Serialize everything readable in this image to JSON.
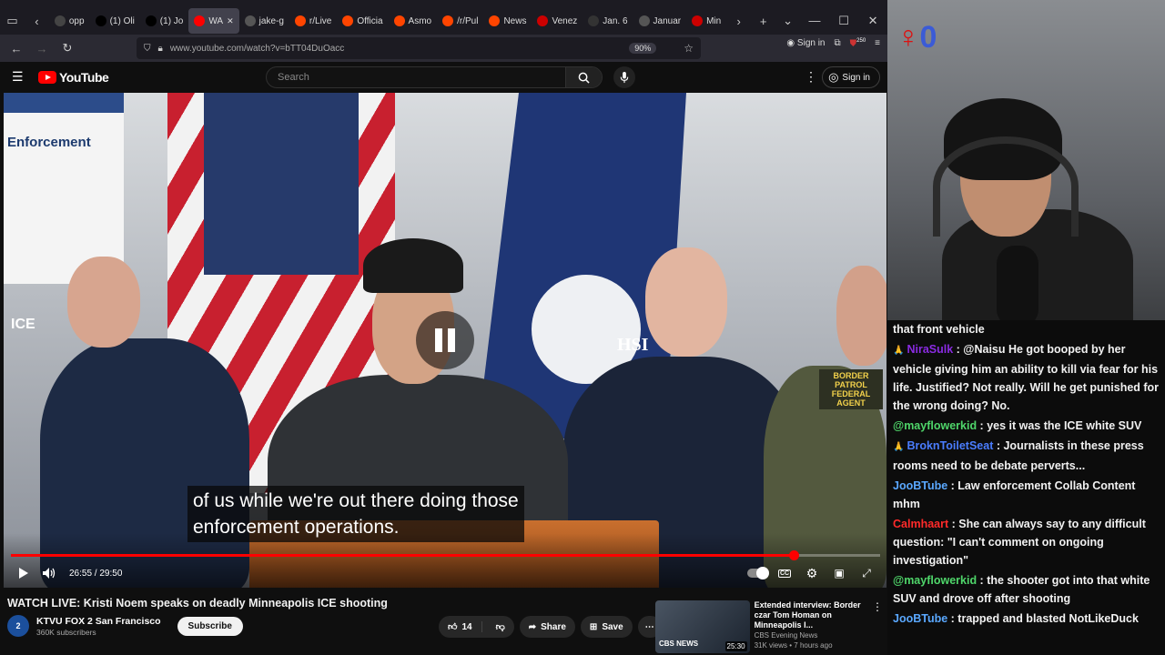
{
  "browser": {
    "tabs": [
      {
        "label": "opp",
        "color": "#444"
      },
      {
        "label": "(1) Oli",
        "color": "#000"
      },
      {
        "label": "(1) Jo",
        "color": "#000"
      },
      {
        "label": "WA",
        "color": "#ff0000",
        "active": true
      },
      {
        "label": "jake-g",
        "color": "#555"
      },
      {
        "label": "r/Live",
        "color": "#ff4500"
      },
      {
        "label": "Officia",
        "color": "#ff4500"
      },
      {
        "label": "Asmo",
        "color": "#ff4500"
      },
      {
        "label": "/r/Pul",
        "color": "#ff4500"
      },
      {
        "label": "News",
        "color": "#ff4500"
      },
      {
        "label": "Venez",
        "color": "#c00"
      },
      {
        "label": "Jan. 6",
        "color": "#333"
      },
      {
        "label": "Januar",
        "color": "#555"
      },
      {
        "label": "Min",
        "color": "#c00"
      }
    ],
    "url": "www.youtube.com/watch?v=bTT04DuOacc",
    "zoom": "90%",
    "signin_label": "Sign in",
    "ext_badge": "250"
  },
  "youtube": {
    "logo_text": "YouTube",
    "search_placeholder": "Search",
    "signin_label": "Sign in"
  },
  "video": {
    "banner_text": "Enforcement",
    "caption_line1": "of us while we're out there doing those",
    "caption_line2": "enforcement operations.",
    "sign_hsi": "HSI",
    "sign_ice": "ICE",
    "sign_bp": "BORDER PATROL FEDERAL AGENT",
    "time": "26:55 / 29:50",
    "progress": 0.902
  },
  "details": {
    "title": "WATCH LIVE: Kristi Noem speaks on deadly Minneapolis ICE shooting",
    "channel_name": "KTVU FOX 2 San Francisco",
    "channel_avatar": "2",
    "subscribers": "360K subscribers",
    "subscribe_label": "Subscribe",
    "likes": "14",
    "share_label": "Share",
    "save_label": "Save"
  },
  "recommendation": {
    "title": "Extended interview: Border czar Tom Homan on Minneapolis I...",
    "channel": "CBS Evening News",
    "meta": "31K views • 7 hours ago",
    "duration": "25:30",
    "thumb_label": "CBS NEWS"
  },
  "stream": {
    "logo_digit": "0"
  },
  "chat": [
    {
      "badge": "",
      "user": "",
      "color": "#ff5a2a",
      "text": "that front vehicle"
    },
    {
      "badge": "🙏",
      "user": "NiraSulk",
      "color": "#8a2be2",
      "text": "@Naisu He got booped by her vehicle giving him an ability to kill via fear for his life. Justified? Not really. Will he get punished for the wrong doing? No."
    },
    {
      "badge": "",
      "user": "@mayflowerkid",
      "color": "#4fd66a",
      "text": "yes it was the ICE white SUV"
    },
    {
      "badge": "🙏",
      "user": "BroknToiletSeat",
      "color": "#4a7dff",
      "text": "Journalists in these press rooms need to be debate perverts..."
    },
    {
      "badge": "",
      "user": "JooBTube",
      "color": "#5aa8ff",
      "text": "Law enforcement Collab Content mhm"
    },
    {
      "badge": "",
      "user": "Calmhaart",
      "color": "#ff2a2a",
      "text": "She can always say to any difficult question: \"I can't comment on ongoing investigation\""
    },
    {
      "badge": "",
      "user": "@mayflowerkid",
      "color": "#4fd66a",
      "text": "the shooter got into that white SUV and drove off after shooting"
    },
    {
      "badge": "",
      "user": "JooBTube",
      "color": "#5aa8ff",
      "text": "trapped and blasted NotLikeDuck"
    }
  ]
}
